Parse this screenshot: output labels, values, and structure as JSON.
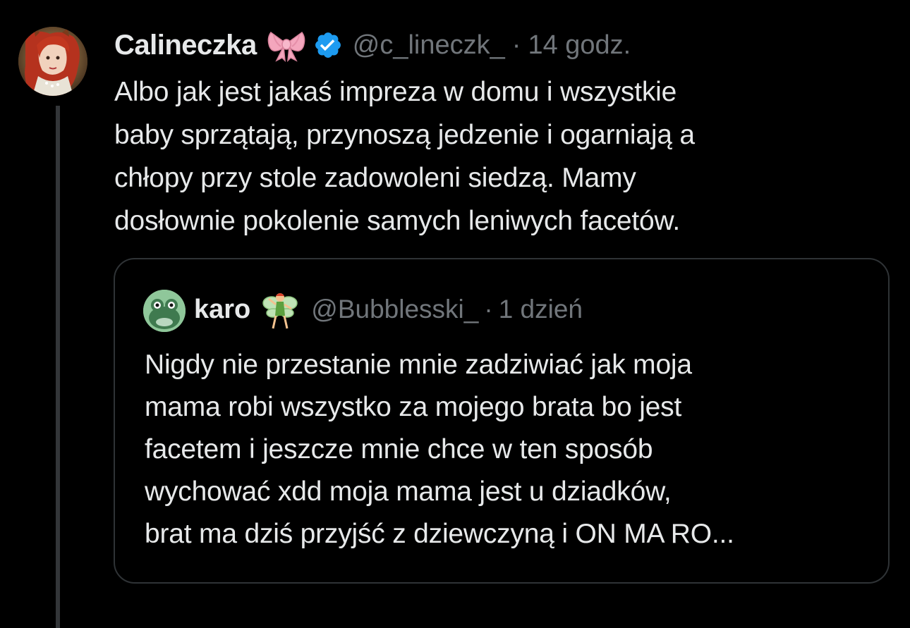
{
  "tweet": {
    "author": {
      "display_name": "Calineczka",
      "handle": "@c_lineczk_",
      "avatar_icon": "avatar-red-haired-woman",
      "name_emoji_icon": "pink-bow-emoji",
      "verified_icon": "verified-badge-icon"
    },
    "separator": "·",
    "time": "14 godz.",
    "text": "Albo jak jest jakaś impreza w domu i wszystkie\nbaby sprzątają, przynoszą jedzenie i ogarniają a\nchłopy przy stole zadowoleni siedzą. Mamy\ndosłownie pokolenie samych leniwych facetów."
  },
  "quoted_tweet": {
    "author": {
      "display_name": "karo",
      "handle": "@Bubblesski_",
      "avatar_icon": "avatar-green-frog",
      "name_emoji_icon": "fairy-emoji"
    },
    "separator": "·",
    "time": "1 dzień",
    "text": "Nigdy nie przestanie mnie zadziwiać jak moja\nmama robi wszystko za mojego brata bo jest\nfacetem i jeszcze mnie chce w ten sposób\nwychować xdd moja mama jest u dziadków,\nbrat ma dziś przyjść z dziewczyną i ON MA RO..."
  },
  "colors": {
    "background": "#000000",
    "primary_text": "#e7e9ea",
    "secondary_text": "#71767b",
    "border": "#2f3336",
    "thread_line": "#333639",
    "verified_blue": "#1d9bf0"
  }
}
